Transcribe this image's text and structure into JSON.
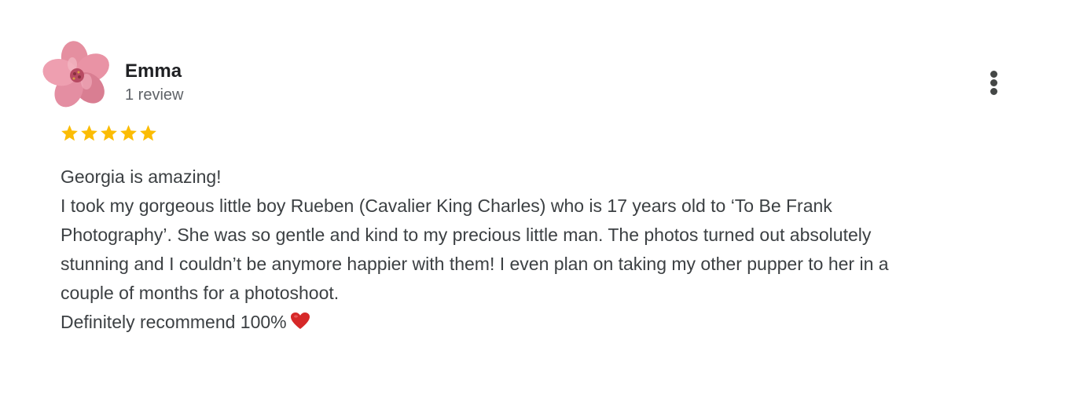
{
  "reviewer": {
    "name": "Emma",
    "review_count": "1 review",
    "avatar_icon": "pink-flower-avatar"
  },
  "rating": {
    "stars": 5,
    "max_stars": 5,
    "star_color": "#fbbc04"
  },
  "menu": {
    "icon": "more-vert-icon"
  },
  "review": {
    "lines": [
      "Georgia is amazing!",
      "I took my gorgeous little boy Rueben (Cavalier King Charles) who is 17 years old to ‘To Be Frank",
      "Photography’. She was so gentle and kind to my precious little man. The photos turned out absolutely",
      "stunning and I couldn’t be anymore happier with them! I even plan on taking my other pupper to her in a",
      "couple of months for a photoshoot.",
      "Definitely recommend 100%"
    ],
    "trailing_icon": "red-heart-icon",
    "heart_color": "#d62828"
  },
  "colors": {
    "text_primary": "#202124",
    "text_secondary": "#5f6368",
    "body_text": "#3c4043"
  }
}
